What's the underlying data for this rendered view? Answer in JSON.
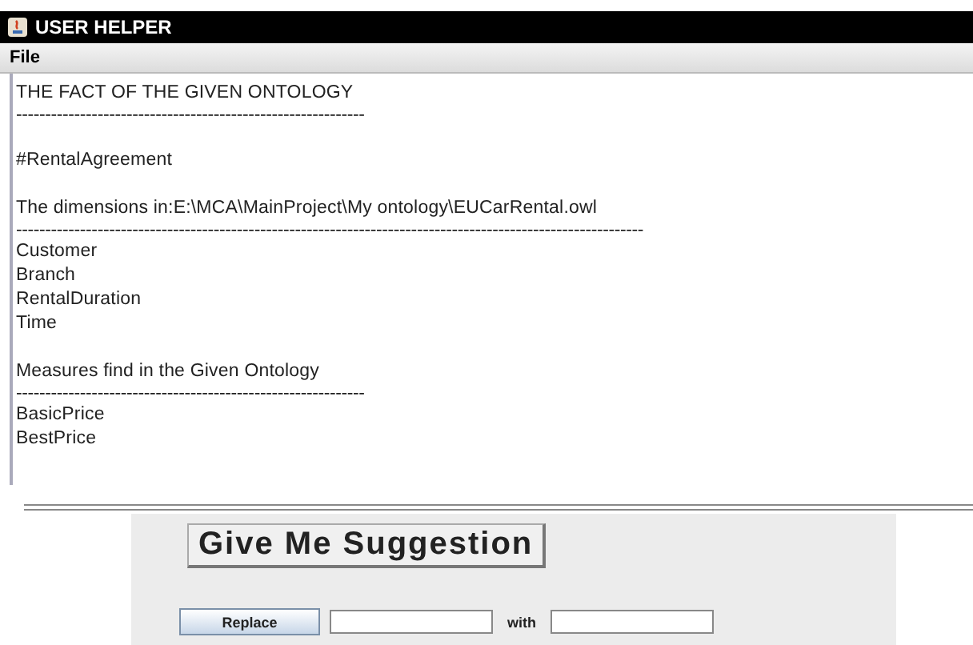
{
  "window": {
    "title": "USER HELPER"
  },
  "menu": [
    "File"
  ],
  "text_area": {
    "blocks": [
      [
        "THE FACT OF THE GIVEN ONTOLOGY",
        "------------------------------------------------------------"
      ],
      [
        "#RentalAgreement"
      ],
      [
        "The dimensions in:E:\\MCA\\MainProject\\My ontology\\EUCarRental.owl",
        "------------------------------------------------------------------------------------------------------------",
        "Customer",
        "Branch",
        "RentalDuration",
        "Time"
      ],
      [
        "Measures find in the Given Ontology",
        "------------------------------------------------------------",
        "BasicPrice",
        "BestPrice"
      ]
    ]
  },
  "suggest_button": "Give Me Suggestion",
  "replace": {
    "button": "Replace",
    "with_label": "with"
  }
}
